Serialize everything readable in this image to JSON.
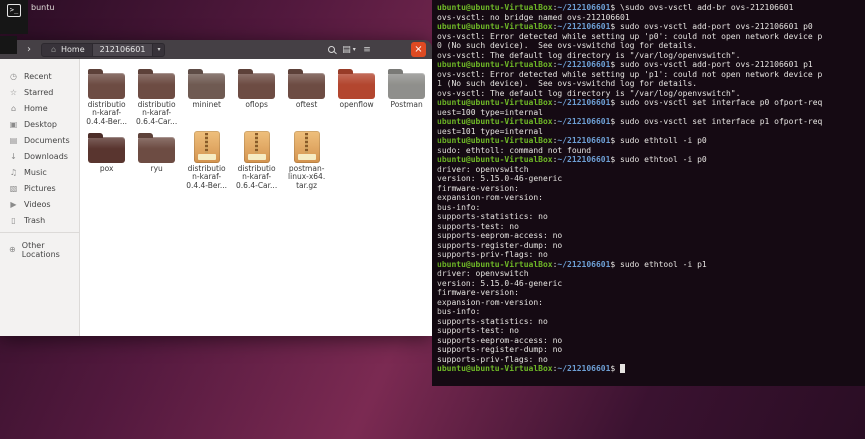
{
  "desktop": {
    "dock_terminal_glyph": ">_",
    "background_title_fragment": "buntu",
    "wallpaper": {
      "c1": "#2a0d24",
      "c2": "#53193e",
      "c3": "#7b2a52",
      "c4": "#3a1230"
    }
  },
  "file_manager": {
    "colors": {
      "headerbar": "#454045",
      "close_button": "#dd4a22",
      "sidebar_bg": "#f3f2f1",
      "folder_default": "#6d4c43"
    },
    "toolbar": {
      "back_icon": "‹",
      "forward_icon": "›",
      "home_icon": "⌂",
      "home_label": "Home",
      "folder_label": "212106601",
      "chevron_icon": "▾",
      "view_icon": "▤",
      "menu_icon": "≡",
      "close_icon": "×"
    },
    "sidebar": [
      {
        "icon": "◷",
        "icon_name": "recent-icon",
        "label": "Recent"
      },
      {
        "icon": "☆",
        "icon_name": "starred-icon",
        "label": "Starred"
      },
      {
        "icon": "⌂",
        "icon_name": "home-icon",
        "label": "Home"
      },
      {
        "icon": "▣",
        "icon_name": "desktop-icon",
        "label": "Desktop"
      },
      {
        "icon": "▤",
        "icon_name": "documents-icon",
        "label": "Documents"
      },
      {
        "icon": "↓",
        "icon_name": "downloads-icon",
        "label": "Downloads"
      },
      {
        "icon": "♫",
        "icon_name": "music-icon",
        "label": "Music"
      },
      {
        "icon": "▧",
        "icon_name": "pictures-icon",
        "label": "Pictures"
      },
      {
        "icon": "▶",
        "icon_name": "videos-icon",
        "label": "Videos"
      },
      {
        "icon": "▯",
        "icon_name": "trash-icon",
        "label": "Trash"
      },
      {
        "separator": true
      },
      {
        "icon": "⊕",
        "icon_name": "other-locations-icon",
        "label": "Other Locations"
      }
    ],
    "files": [
      {
        "type": "folder",
        "color": "#6d4c43",
        "lines": [
          "distributio",
          "n-karaf-",
          "0.4.4-Ber..."
        ]
      },
      {
        "type": "folder",
        "color": "#6d4c43",
        "lines": [
          "distributio",
          "n-karaf-",
          "0.6.4-Car..."
        ]
      },
      {
        "type": "folder",
        "color": "#6f5a52",
        "lines": [
          "mininet"
        ]
      },
      {
        "type": "folder",
        "color": "#6d4c43",
        "lines": [
          "oflops"
        ]
      },
      {
        "type": "folder",
        "color": "#6d4c43",
        "lines": [
          "oftest"
        ]
      },
      {
        "type": "folder",
        "color": "#b3462f",
        "lines": [
          "openflow"
        ]
      },
      {
        "type": "folder",
        "color": "#8f8f8c",
        "lines": [
          "Postman"
        ]
      },
      {
        "type": "folder",
        "color": "#59352f",
        "lines": [
          "pox"
        ]
      },
      {
        "type": "folder",
        "color": "#6d4c43",
        "lines": [
          "ryu"
        ]
      },
      {
        "type": "archive",
        "lines": [
          "distributio",
          "n-karaf-",
          "0.4.4-Ber..."
        ]
      },
      {
        "type": "archive",
        "lines": [
          "distributio",
          "n-karaf-",
          "0.6.4-Car..."
        ]
      },
      {
        "type": "archive",
        "lines": [
          "postman-",
          "linux-x64.",
          "tar.gz"
        ]
      }
    ]
  },
  "terminal": {
    "prompt_user": "ubuntu@ubuntu-VirtualBox",
    "prompt_separator": ":",
    "prompt_path": "~/212106601",
    "prompt_suffix": "$ ",
    "colors": {
      "background": "#150a13",
      "text": "#e6e4e1",
      "user": "#6fb927",
      "path": "#6d9fd4"
    },
    "lines": [
      {
        "cmd": "\\sudo ovs-vsctl add-br ovs-212106601"
      },
      {
        "out": "ovs-vsctl: no bridge named ovs-212106601"
      },
      {
        "cmd": "sudo ovs-vsctl add-port ovs-212106601 p0"
      },
      {
        "out": "ovs-vsctl: Error detected while setting up 'p0': could not open network device p"
      },
      {
        "out": "0 (No such device).  See ovs-vswitchd log for details."
      },
      {
        "out": "ovs-vsctl: The default log directory is \"/var/log/openvswitch\"."
      },
      {
        "cmd": "sudo ovs-vsctl add-port ovs-212106601 p1"
      },
      {
        "out": "ovs-vsctl: Error detected while setting up 'p1': could not open network device p"
      },
      {
        "out": "1 (No such device).  See ovs-vswitchd log for details."
      },
      {
        "out": "ovs-vsctl: The default log directory is \"/var/log/openvswitch\"."
      },
      {
        "cmd": "sudo ovs-vsctl set interface p0 ofport-req"
      },
      {
        "out": "uest=100 type=internal"
      },
      {
        "cmd": "sudo ovs-vsctl set interface p1 ofport-req"
      },
      {
        "out": "uest=101 type=internal"
      },
      {
        "cmd": "sudo ethtoll -i p0"
      },
      {
        "out": "sudo: ethtoll: command not found"
      },
      {
        "cmd": "sudo ethtool -i p0"
      },
      {
        "out": "driver: openvswitch"
      },
      {
        "out": "version: 5.15.0-46-generic"
      },
      {
        "out": "firmware-version:"
      },
      {
        "out": "expansion-rom-version:"
      },
      {
        "out": "bus-info:"
      },
      {
        "out": "supports-statistics: no"
      },
      {
        "out": "supports-test: no"
      },
      {
        "out": "supports-eeprom-access: no"
      },
      {
        "out": "supports-register-dump: no"
      },
      {
        "out": "supports-priv-flags: no"
      },
      {
        "cmd": "sudo ethtool -i p1"
      },
      {
        "out": "driver: openvswitch"
      },
      {
        "out": "version: 5.15.0-46-generic"
      },
      {
        "out": "firmware-version:"
      },
      {
        "out": "expansion-rom-version:"
      },
      {
        "out": "bus-info:"
      },
      {
        "out": "supports-statistics: no"
      },
      {
        "out": "supports-test: no"
      },
      {
        "out": "supports-eeprom-access: no"
      },
      {
        "out": "supports-register-dump: no"
      },
      {
        "out": "supports-priv-flags: no"
      },
      {
        "cmd": "",
        "cursor": true
      }
    ]
  }
}
